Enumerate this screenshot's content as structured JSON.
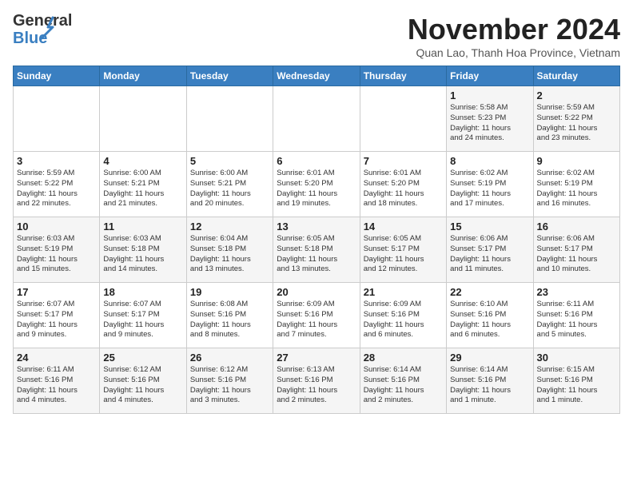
{
  "logo": {
    "line1": "General",
    "line2": "Blue"
  },
  "title": "November 2024",
  "location": "Quan Lao, Thanh Hoa Province, Vietnam",
  "days_of_week": [
    "Sunday",
    "Monday",
    "Tuesday",
    "Wednesday",
    "Thursday",
    "Friday",
    "Saturday"
  ],
  "weeks": [
    [
      {
        "day": "",
        "info": ""
      },
      {
        "day": "",
        "info": ""
      },
      {
        "day": "",
        "info": ""
      },
      {
        "day": "",
        "info": ""
      },
      {
        "day": "",
        "info": ""
      },
      {
        "day": "1",
        "info": "Sunrise: 5:58 AM\nSunset: 5:23 PM\nDaylight: 11 hours\nand 24 minutes."
      },
      {
        "day": "2",
        "info": "Sunrise: 5:59 AM\nSunset: 5:22 PM\nDaylight: 11 hours\nand 23 minutes."
      }
    ],
    [
      {
        "day": "3",
        "info": "Sunrise: 5:59 AM\nSunset: 5:22 PM\nDaylight: 11 hours\nand 22 minutes."
      },
      {
        "day": "4",
        "info": "Sunrise: 6:00 AM\nSunset: 5:21 PM\nDaylight: 11 hours\nand 21 minutes."
      },
      {
        "day": "5",
        "info": "Sunrise: 6:00 AM\nSunset: 5:21 PM\nDaylight: 11 hours\nand 20 minutes."
      },
      {
        "day": "6",
        "info": "Sunrise: 6:01 AM\nSunset: 5:20 PM\nDaylight: 11 hours\nand 19 minutes."
      },
      {
        "day": "7",
        "info": "Sunrise: 6:01 AM\nSunset: 5:20 PM\nDaylight: 11 hours\nand 18 minutes."
      },
      {
        "day": "8",
        "info": "Sunrise: 6:02 AM\nSunset: 5:19 PM\nDaylight: 11 hours\nand 17 minutes."
      },
      {
        "day": "9",
        "info": "Sunrise: 6:02 AM\nSunset: 5:19 PM\nDaylight: 11 hours\nand 16 minutes."
      }
    ],
    [
      {
        "day": "10",
        "info": "Sunrise: 6:03 AM\nSunset: 5:19 PM\nDaylight: 11 hours\nand 15 minutes."
      },
      {
        "day": "11",
        "info": "Sunrise: 6:03 AM\nSunset: 5:18 PM\nDaylight: 11 hours\nand 14 minutes."
      },
      {
        "day": "12",
        "info": "Sunrise: 6:04 AM\nSunset: 5:18 PM\nDaylight: 11 hours\nand 13 minutes."
      },
      {
        "day": "13",
        "info": "Sunrise: 6:05 AM\nSunset: 5:18 PM\nDaylight: 11 hours\nand 13 minutes."
      },
      {
        "day": "14",
        "info": "Sunrise: 6:05 AM\nSunset: 5:17 PM\nDaylight: 11 hours\nand 12 minutes."
      },
      {
        "day": "15",
        "info": "Sunrise: 6:06 AM\nSunset: 5:17 PM\nDaylight: 11 hours\nand 11 minutes."
      },
      {
        "day": "16",
        "info": "Sunrise: 6:06 AM\nSunset: 5:17 PM\nDaylight: 11 hours\nand 10 minutes."
      }
    ],
    [
      {
        "day": "17",
        "info": "Sunrise: 6:07 AM\nSunset: 5:17 PM\nDaylight: 11 hours\nand 9 minutes."
      },
      {
        "day": "18",
        "info": "Sunrise: 6:07 AM\nSunset: 5:17 PM\nDaylight: 11 hours\nand 9 minutes."
      },
      {
        "day": "19",
        "info": "Sunrise: 6:08 AM\nSunset: 5:16 PM\nDaylight: 11 hours\nand 8 minutes."
      },
      {
        "day": "20",
        "info": "Sunrise: 6:09 AM\nSunset: 5:16 PM\nDaylight: 11 hours\nand 7 minutes."
      },
      {
        "day": "21",
        "info": "Sunrise: 6:09 AM\nSunset: 5:16 PM\nDaylight: 11 hours\nand 6 minutes."
      },
      {
        "day": "22",
        "info": "Sunrise: 6:10 AM\nSunset: 5:16 PM\nDaylight: 11 hours\nand 6 minutes."
      },
      {
        "day": "23",
        "info": "Sunrise: 6:11 AM\nSunset: 5:16 PM\nDaylight: 11 hours\nand 5 minutes."
      }
    ],
    [
      {
        "day": "24",
        "info": "Sunrise: 6:11 AM\nSunset: 5:16 PM\nDaylight: 11 hours\nand 4 minutes."
      },
      {
        "day": "25",
        "info": "Sunrise: 6:12 AM\nSunset: 5:16 PM\nDaylight: 11 hours\nand 4 minutes."
      },
      {
        "day": "26",
        "info": "Sunrise: 6:12 AM\nSunset: 5:16 PM\nDaylight: 11 hours\nand 3 minutes."
      },
      {
        "day": "27",
        "info": "Sunrise: 6:13 AM\nSunset: 5:16 PM\nDaylight: 11 hours\nand 2 minutes."
      },
      {
        "day": "28",
        "info": "Sunrise: 6:14 AM\nSunset: 5:16 PM\nDaylight: 11 hours\nand 2 minutes."
      },
      {
        "day": "29",
        "info": "Sunrise: 6:14 AM\nSunset: 5:16 PM\nDaylight: 11 hours\nand 1 minute."
      },
      {
        "day": "30",
        "info": "Sunrise: 6:15 AM\nSunset: 5:16 PM\nDaylight: 11 hours\nand 1 minute."
      }
    ]
  ]
}
